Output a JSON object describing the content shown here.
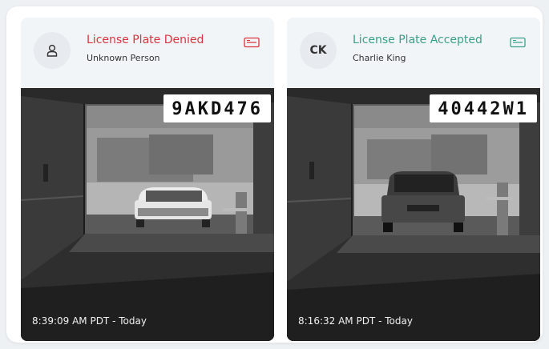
{
  "colors": {
    "denied": "#d9353f",
    "accepted": "#3aa18a"
  },
  "cards": [
    {
      "status": "License Plate Denied",
      "status_color": "#d9353f",
      "person": "Unknown Person",
      "avatar": {
        "type": "person-icon",
        "initials": ""
      },
      "plate": "9AKD476",
      "timestamp": "8:39:09 AM PDT - Today",
      "icon": "license-plate-icon"
    },
    {
      "status": "License Plate Accepted",
      "status_color": "#3aa18a",
      "person": "Charlie King",
      "avatar": {
        "type": "initials",
        "initials": "CK"
      },
      "plate": "40442W1",
      "timestamp": "8:16:32 AM PDT - Today",
      "icon": "license-plate-icon"
    }
  ]
}
